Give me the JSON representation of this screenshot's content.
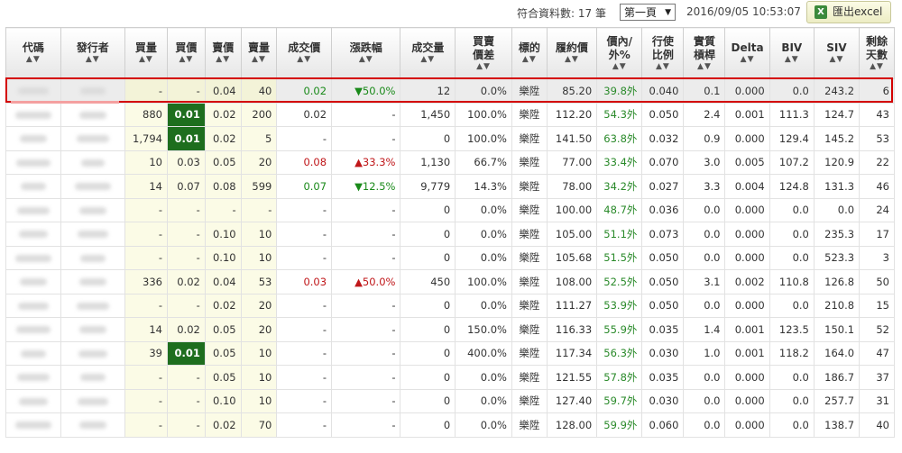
{
  "topbar": {
    "count_label": "符合資料數: 17 筆",
    "page_select": "第一頁",
    "timestamp": "2016/09/05 10:53:07",
    "excel_label": "匯出excel"
  },
  "columns": [
    {
      "key": "code",
      "l1": "代碼",
      "l2": ""
    },
    {
      "key": "issuer",
      "l1": "發行者",
      "l2": ""
    },
    {
      "key": "bid_qty",
      "l1": "買量",
      "l2": ""
    },
    {
      "key": "bid",
      "l1": "買價",
      "l2": ""
    },
    {
      "key": "ask",
      "l1": "賣價",
      "l2": ""
    },
    {
      "key": "ask_qty",
      "l1": "賣量",
      "l2": ""
    },
    {
      "key": "last",
      "l1": "成交價",
      "l2": ""
    },
    {
      "key": "chg",
      "l1": "漲跌幅",
      "l2": ""
    },
    {
      "key": "vol",
      "l1": "成交量",
      "l2": ""
    },
    {
      "key": "spread",
      "l1": "買賣",
      "l2": "價差"
    },
    {
      "key": "underlying",
      "l1": "標的",
      "l2": ""
    },
    {
      "key": "strike",
      "l1": "履約價",
      "l2": ""
    },
    {
      "key": "moneyness",
      "l1": "價內/",
      "l2": "外%"
    },
    {
      "key": "ratio",
      "l1": "行使",
      "l2": "比例"
    },
    {
      "key": "lev",
      "l1": "實質",
      "l2": "槓桿"
    },
    {
      "key": "delta",
      "l1": "Delta",
      "l2": ""
    },
    {
      "key": "biv",
      "l1": "BIV",
      "l2": ""
    },
    {
      "key": "siv",
      "l1": "SIV",
      "l2": ""
    },
    {
      "key": "days",
      "l1": "剩餘",
      "l2": "天數"
    }
  ],
  "sort_glyph": "▲▼",
  "rows": [
    {
      "bid_qty": "-",
      "bid": "-",
      "ask": "0.04",
      "ask_qty": "40",
      "last": "0.02",
      "last_dir": "down",
      "chg": "▼50.0%",
      "chg_dir": "down",
      "vol": "12",
      "spread": "0.0%",
      "underlying": "樂陞",
      "strike": "85.20",
      "moneyness": "39.8外",
      "ratio": "0.040",
      "lev": "0.1",
      "delta": "0.000",
      "biv": "0.0",
      "siv": "243.2",
      "days": "6"
    },
    {
      "bid_qty": "880",
      "bid": "0.01",
      "bid_green": true,
      "ask": "0.02",
      "ask_qty": "200",
      "last": "0.02",
      "last_dir": "",
      "chg": "-",
      "chg_dir": "",
      "vol": "1,450",
      "spread": "100.0%",
      "underlying": "樂陞",
      "strike": "112.20",
      "moneyness": "54.3外",
      "ratio": "0.050",
      "lev": "2.4",
      "delta": "0.001",
      "biv": "111.3",
      "siv": "124.7",
      "days": "43"
    },
    {
      "bid_qty": "1,794",
      "bid": "0.01",
      "bid_green": true,
      "ask": "0.02",
      "ask_qty": "5",
      "last": "-",
      "last_dir": "",
      "chg": "-",
      "chg_dir": "",
      "vol": "0",
      "spread": "100.0%",
      "underlying": "樂陞",
      "strike": "141.50",
      "moneyness": "63.8外",
      "ratio": "0.032",
      "lev": "0.9",
      "delta": "0.000",
      "biv": "129.4",
      "siv": "145.2",
      "days": "53"
    },
    {
      "bid_qty": "10",
      "bid": "0.03",
      "ask": "0.05",
      "ask_qty": "20",
      "last": "0.08",
      "last_dir": "up",
      "chg": "▲33.3%",
      "chg_dir": "up",
      "vol": "1,130",
      "spread": "66.7%",
      "underlying": "樂陞",
      "strike": "77.00",
      "moneyness": "33.4外",
      "ratio": "0.070",
      "lev": "3.0",
      "delta": "0.005",
      "biv": "107.2",
      "siv": "120.9",
      "days": "22"
    },
    {
      "bid_qty": "14",
      "bid": "0.07",
      "ask": "0.08",
      "ask_qty": "599",
      "last": "0.07",
      "last_dir": "down",
      "chg": "▼12.5%",
      "chg_dir": "down",
      "vol": "9,779",
      "spread": "14.3%",
      "underlying": "樂陞",
      "strike": "78.00",
      "moneyness": "34.2外",
      "ratio": "0.027",
      "lev": "3.3",
      "delta": "0.004",
      "biv": "124.8",
      "siv": "131.3",
      "days": "46"
    },
    {
      "bid_qty": "-",
      "bid": "-",
      "ask": "-",
      "ask_qty": "-",
      "last": "-",
      "last_dir": "",
      "chg": "-",
      "chg_dir": "",
      "vol": "0",
      "spread": "0.0%",
      "underlying": "樂陞",
      "strike": "100.00",
      "moneyness": "48.7外",
      "ratio": "0.036",
      "lev": "0.0",
      "delta": "0.000",
      "biv": "0.0",
      "siv": "0.0",
      "days": "24"
    },
    {
      "bid_qty": "-",
      "bid": "-",
      "ask": "0.10",
      "ask_qty": "10",
      "last": "-",
      "last_dir": "",
      "chg": "-",
      "chg_dir": "",
      "vol": "0",
      "spread": "0.0%",
      "underlying": "樂陞",
      "strike": "105.00",
      "moneyness": "51.1外",
      "ratio": "0.073",
      "lev": "0.0",
      "delta": "0.000",
      "biv": "0.0",
      "siv": "235.3",
      "days": "17"
    },
    {
      "bid_qty": "-",
      "bid": "-",
      "ask": "0.10",
      "ask_qty": "10",
      "last": "-",
      "last_dir": "",
      "chg": "-",
      "chg_dir": "",
      "vol": "0",
      "spread": "0.0%",
      "underlying": "樂陞",
      "strike": "105.68",
      "moneyness": "51.5外",
      "ratio": "0.050",
      "lev": "0.0",
      "delta": "0.000",
      "biv": "0.0",
      "siv": "523.3",
      "days": "3"
    },
    {
      "bid_qty": "336",
      "bid": "0.02",
      "ask": "0.04",
      "ask_qty": "53",
      "last": "0.03",
      "last_dir": "up",
      "chg": "▲50.0%",
      "chg_dir": "up",
      "vol": "450",
      "spread": "100.0%",
      "underlying": "樂陞",
      "strike": "108.00",
      "moneyness": "52.5外",
      "ratio": "0.050",
      "lev": "3.1",
      "delta": "0.002",
      "biv": "110.8",
      "siv": "126.8",
      "days": "50"
    },
    {
      "bid_qty": "-",
      "bid": "-",
      "ask": "0.02",
      "ask_qty": "20",
      "last": "-",
      "last_dir": "",
      "chg": "-",
      "chg_dir": "",
      "vol": "0",
      "spread": "0.0%",
      "underlying": "樂陞",
      "strike": "111.27",
      "moneyness": "53.9外",
      "ratio": "0.050",
      "lev": "0.0",
      "delta": "0.000",
      "biv": "0.0",
      "siv": "210.8",
      "days": "15"
    },
    {
      "bid_qty": "14",
      "bid": "0.02",
      "ask": "0.05",
      "ask_qty": "20",
      "last": "-",
      "last_dir": "",
      "chg": "-",
      "chg_dir": "",
      "vol": "0",
      "spread": "150.0%",
      "underlying": "樂陞",
      "strike": "116.33",
      "moneyness": "55.9外",
      "ratio": "0.035",
      "lev": "1.4",
      "delta": "0.001",
      "biv": "123.5",
      "siv": "150.1",
      "days": "52"
    },
    {
      "bid_qty": "39",
      "bid": "0.01",
      "bid_green": true,
      "ask": "0.05",
      "ask_qty": "10",
      "last": "-",
      "last_dir": "",
      "chg": "-",
      "chg_dir": "",
      "vol": "0",
      "spread": "400.0%",
      "underlying": "樂陞",
      "strike": "117.34",
      "moneyness": "56.3外",
      "ratio": "0.030",
      "lev": "1.0",
      "delta": "0.001",
      "biv": "118.2",
      "siv": "164.0",
      "days": "47"
    },
    {
      "bid_qty": "-",
      "bid": "-",
      "ask": "0.05",
      "ask_qty": "10",
      "last": "-",
      "last_dir": "",
      "chg": "-",
      "chg_dir": "",
      "vol": "0",
      "spread": "0.0%",
      "underlying": "樂陞",
      "strike": "121.55",
      "moneyness": "57.8外",
      "ratio": "0.035",
      "lev": "0.0",
      "delta": "0.000",
      "biv": "0.0",
      "siv": "186.7",
      "days": "37"
    },
    {
      "bid_qty": "-",
      "bid": "-",
      "ask": "0.10",
      "ask_qty": "10",
      "last": "-",
      "last_dir": "",
      "chg": "-",
      "chg_dir": "",
      "vol": "0",
      "spread": "0.0%",
      "underlying": "樂陞",
      "strike": "127.40",
      "moneyness": "59.7外",
      "ratio": "0.030",
      "lev": "0.0",
      "delta": "0.000",
      "biv": "0.0",
      "siv": "257.7",
      "days": "31"
    },
    {
      "bid_qty": "-",
      "bid": "-",
      "ask": "0.02",
      "ask_qty": "70",
      "last": "-",
      "last_dir": "",
      "chg": "-",
      "chg_dir": "",
      "vol": "0",
      "spread": "0.0%",
      "underlying": "樂陞",
      "strike": "128.00",
      "moneyness": "59.9外",
      "ratio": "0.060",
      "lev": "0.0",
      "delta": "0.000",
      "biv": "0.0",
      "siv": "138.7",
      "days": "40"
    }
  ],
  "colors": {
    "bid_green_bg": "#1e6e1e",
    "quote_bg": "#fbfbe6",
    "up": "#c0171a",
    "down": "#1a8a1a",
    "highlight_border": "#d40000"
  }
}
